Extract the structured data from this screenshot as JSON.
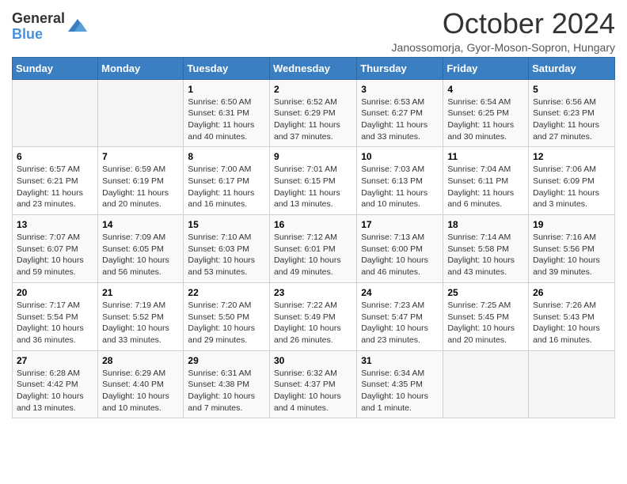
{
  "header": {
    "logo_general": "General",
    "logo_blue": "Blue",
    "month_title": "October 2024",
    "location": "Janossomorja, Gyor-Moson-Sopron, Hungary"
  },
  "calendar": {
    "days_of_week": [
      "Sunday",
      "Monday",
      "Tuesday",
      "Wednesday",
      "Thursday",
      "Friday",
      "Saturday"
    ],
    "weeks": [
      [
        {
          "day": "",
          "info": ""
        },
        {
          "day": "",
          "info": ""
        },
        {
          "day": "1",
          "info": "Sunrise: 6:50 AM\nSunset: 6:31 PM\nDaylight: 11 hours and 40 minutes."
        },
        {
          "day": "2",
          "info": "Sunrise: 6:52 AM\nSunset: 6:29 PM\nDaylight: 11 hours and 37 minutes."
        },
        {
          "day": "3",
          "info": "Sunrise: 6:53 AM\nSunset: 6:27 PM\nDaylight: 11 hours and 33 minutes."
        },
        {
          "day": "4",
          "info": "Sunrise: 6:54 AM\nSunset: 6:25 PM\nDaylight: 11 hours and 30 minutes."
        },
        {
          "day": "5",
          "info": "Sunrise: 6:56 AM\nSunset: 6:23 PM\nDaylight: 11 hours and 27 minutes."
        }
      ],
      [
        {
          "day": "6",
          "info": "Sunrise: 6:57 AM\nSunset: 6:21 PM\nDaylight: 11 hours and 23 minutes."
        },
        {
          "day": "7",
          "info": "Sunrise: 6:59 AM\nSunset: 6:19 PM\nDaylight: 11 hours and 20 minutes."
        },
        {
          "day": "8",
          "info": "Sunrise: 7:00 AM\nSunset: 6:17 PM\nDaylight: 11 hours and 16 minutes."
        },
        {
          "day": "9",
          "info": "Sunrise: 7:01 AM\nSunset: 6:15 PM\nDaylight: 11 hours and 13 minutes."
        },
        {
          "day": "10",
          "info": "Sunrise: 7:03 AM\nSunset: 6:13 PM\nDaylight: 11 hours and 10 minutes."
        },
        {
          "day": "11",
          "info": "Sunrise: 7:04 AM\nSunset: 6:11 PM\nDaylight: 11 hours and 6 minutes."
        },
        {
          "day": "12",
          "info": "Sunrise: 7:06 AM\nSunset: 6:09 PM\nDaylight: 11 hours and 3 minutes."
        }
      ],
      [
        {
          "day": "13",
          "info": "Sunrise: 7:07 AM\nSunset: 6:07 PM\nDaylight: 10 hours and 59 minutes."
        },
        {
          "day": "14",
          "info": "Sunrise: 7:09 AM\nSunset: 6:05 PM\nDaylight: 10 hours and 56 minutes."
        },
        {
          "day": "15",
          "info": "Sunrise: 7:10 AM\nSunset: 6:03 PM\nDaylight: 10 hours and 53 minutes."
        },
        {
          "day": "16",
          "info": "Sunrise: 7:12 AM\nSunset: 6:01 PM\nDaylight: 10 hours and 49 minutes."
        },
        {
          "day": "17",
          "info": "Sunrise: 7:13 AM\nSunset: 6:00 PM\nDaylight: 10 hours and 46 minutes."
        },
        {
          "day": "18",
          "info": "Sunrise: 7:14 AM\nSunset: 5:58 PM\nDaylight: 10 hours and 43 minutes."
        },
        {
          "day": "19",
          "info": "Sunrise: 7:16 AM\nSunset: 5:56 PM\nDaylight: 10 hours and 39 minutes."
        }
      ],
      [
        {
          "day": "20",
          "info": "Sunrise: 7:17 AM\nSunset: 5:54 PM\nDaylight: 10 hours and 36 minutes."
        },
        {
          "day": "21",
          "info": "Sunrise: 7:19 AM\nSunset: 5:52 PM\nDaylight: 10 hours and 33 minutes."
        },
        {
          "day": "22",
          "info": "Sunrise: 7:20 AM\nSunset: 5:50 PM\nDaylight: 10 hours and 29 minutes."
        },
        {
          "day": "23",
          "info": "Sunrise: 7:22 AM\nSunset: 5:49 PM\nDaylight: 10 hours and 26 minutes."
        },
        {
          "day": "24",
          "info": "Sunrise: 7:23 AM\nSunset: 5:47 PM\nDaylight: 10 hours and 23 minutes."
        },
        {
          "day": "25",
          "info": "Sunrise: 7:25 AM\nSunset: 5:45 PM\nDaylight: 10 hours and 20 minutes."
        },
        {
          "day": "26",
          "info": "Sunrise: 7:26 AM\nSunset: 5:43 PM\nDaylight: 10 hours and 16 minutes."
        }
      ],
      [
        {
          "day": "27",
          "info": "Sunrise: 6:28 AM\nSunset: 4:42 PM\nDaylight: 10 hours and 13 minutes."
        },
        {
          "day": "28",
          "info": "Sunrise: 6:29 AM\nSunset: 4:40 PM\nDaylight: 10 hours and 10 minutes."
        },
        {
          "day": "29",
          "info": "Sunrise: 6:31 AM\nSunset: 4:38 PM\nDaylight: 10 hours and 7 minutes."
        },
        {
          "day": "30",
          "info": "Sunrise: 6:32 AM\nSunset: 4:37 PM\nDaylight: 10 hours and 4 minutes."
        },
        {
          "day": "31",
          "info": "Sunrise: 6:34 AM\nSunset: 4:35 PM\nDaylight: 10 hours and 1 minute."
        },
        {
          "day": "",
          "info": ""
        },
        {
          "day": "",
          "info": ""
        }
      ]
    ]
  }
}
